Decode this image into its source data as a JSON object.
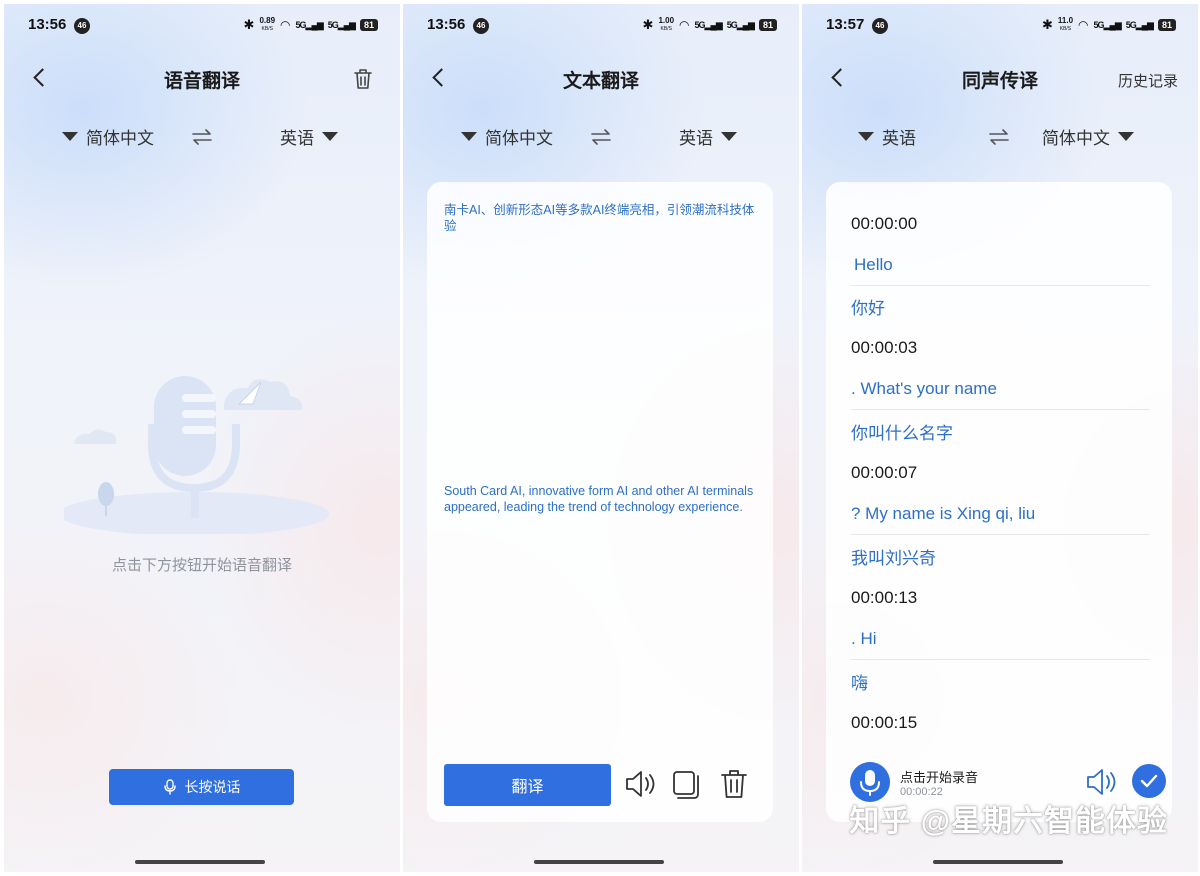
{
  "status_bars": [
    {
      "time": "13:56",
      "net_badge": "46",
      "speed": "0.89",
      "speed_unit": "KB/S",
      "battery": "81"
    },
    {
      "time": "13:56",
      "net_badge": "46",
      "speed": "1.00",
      "speed_unit": "KB/S",
      "battery": "81"
    },
    {
      "time": "13:57",
      "net_badge": "46",
      "speed": "11.0",
      "speed_unit": "KB/S",
      "battery": "81"
    }
  ],
  "voice": {
    "title": "语音翻译",
    "source_lang": "简体中文",
    "target_lang": "英语",
    "hint": "点击下方按钮开始语音翻译",
    "hold_button": "长按说话"
  },
  "text": {
    "title": "文本翻译",
    "source_lang": "简体中文",
    "target_lang": "英语",
    "source_text": "南卡AI、创新形态AI等多款AI终端亮相，引领潮流科技体验",
    "output_text": "South Card AI, innovative form AI and other AI terminals appeared, leading the trend of technology experience.",
    "translate_button": "翻译"
  },
  "simul": {
    "title": "同声传译",
    "history": "历史记录",
    "source_lang": "英语",
    "target_lang": "简体中文",
    "transcript": [
      {
        "kind": "ts",
        "text": "00:00:00"
      },
      {
        "kind": "en",
        "text": "Hello"
      },
      {
        "kind": "zh",
        "text": "你好"
      },
      {
        "kind": "ts",
        "text": "00:00:03"
      },
      {
        "kind": "en",
        "text": ". What's your name"
      },
      {
        "kind": "zh",
        "text": "你叫什么名字"
      },
      {
        "kind": "ts",
        "text": "00:00:07"
      },
      {
        "kind": "en",
        "text": "? My name is Xing qi, liu"
      },
      {
        "kind": "zh",
        "text": "我叫刘兴奇"
      },
      {
        "kind": "ts",
        "text": "00:00:13"
      },
      {
        "kind": "en",
        "text": ". Hi"
      },
      {
        "kind": "zh",
        "text": "嗨"
      },
      {
        "kind": "ts",
        "text": "00:00:15"
      }
    ],
    "record_label": "点击开始录音",
    "record_time": "00:00:22"
  },
  "watermark": "知乎 @星期六智能体验",
  "colors": {
    "accent": "#2f6fe0",
    "text_blue": "#2d6fc6",
    "hint_gray": "#8f949c"
  }
}
